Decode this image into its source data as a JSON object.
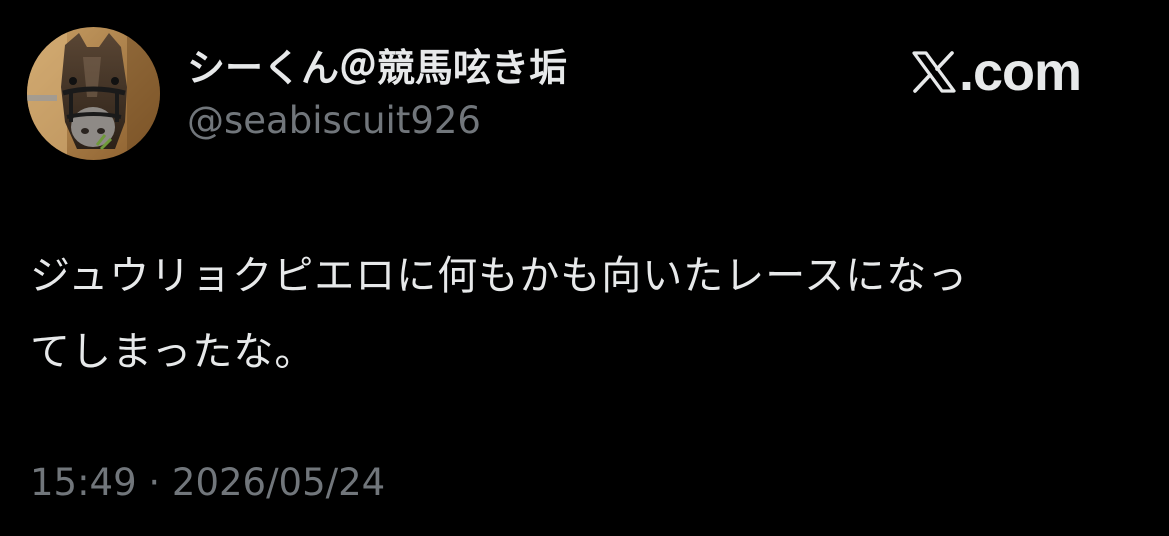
{
  "header": {
    "display_name": "シーくん＠競馬呟き垢",
    "handle": "@seabiscuit926",
    "avatar_icon": "horse-avatar-icon",
    "brand": {
      "icon": "x-logo-icon",
      "text": ".com"
    }
  },
  "tweet": {
    "lines": [
      "ジュウリョクピエロに何もかも向いたレースになっ",
      "てしまったな。"
    ]
  },
  "meta": {
    "timestamp": "15:49 · 2026/05/24"
  },
  "colors": {
    "background": "#000000",
    "text_primary": "#e7e9ea",
    "text_secondary": "#71767b"
  }
}
